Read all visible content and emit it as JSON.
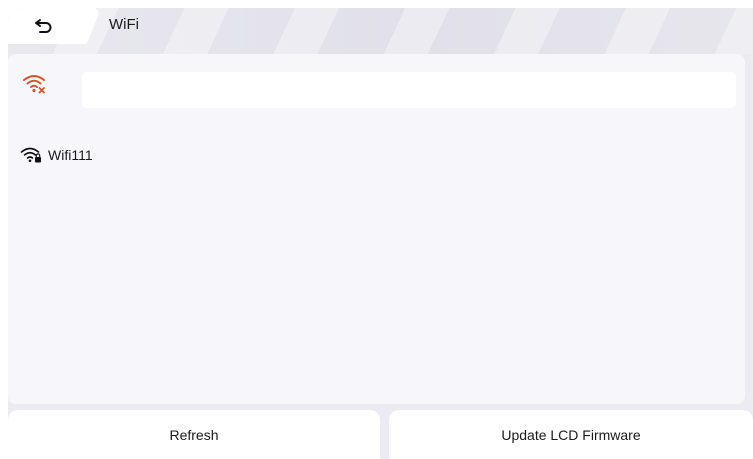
{
  "header": {
    "title": "WiFi",
    "back_icon": "back-arrow-icon"
  },
  "connection": {
    "status_icon": "wifi-disconnected-icon",
    "status_color": "#d9532a",
    "ssid_value": "",
    "ssid_placeholder": ""
  },
  "networks": [
    {
      "name": "Wifi111",
      "icon": "wifi-locked-icon"
    }
  ],
  "buttons": {
    "refresh_label": "Refresh",
    "update_label": "Update LCD Firmware"
  }
}
